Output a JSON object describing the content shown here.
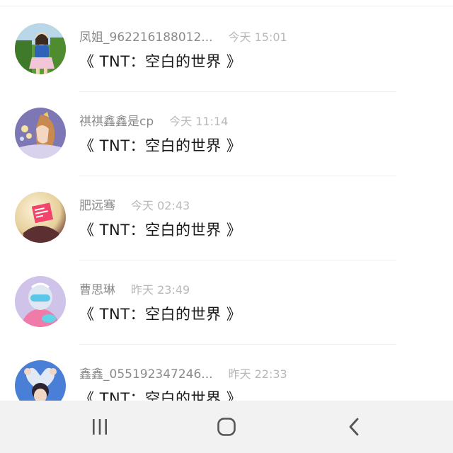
{
  "feed": {
    "items": [
      {
        "name": "凤姐_962216188012...",
        "time": "今天 15:01",
        "message": "《 TNT：空白的世界 》",
        "avatar_icon": "avatar-girl-photo"
      },
      {
        "name": "祺祺鑫鑫是cp",
        "time": "今天 11:14",
        "message": "《 TNT：空白的世界 》",
        "avatar_icon": "avatar-anime-girl"
      },
      {
        "name": "肥远骞",
        "time": "今天 02:43",
        "message": "《 TNT：空白的世界 》",
        "avatar_icon": "avatar-love-note"
      },
      {
        "name": "曹思琳",
        "time": "昨天 23:49",
        "message": "《 TNT：空白的世界 》",
        "avatar_icon": "avatar-helmet-figure"
      },
      {
        "name": "鑫鑫_055192347246...",
        "time": "昨天 22:33",
        "message": "《 TNT：空白的世界 》",
        "avatar_icon": "avatar-heart-hands"
      }
    ]
  },
  "navbar": {
    "buttons": [
      "recent-apps-icon",
      "home-icon",
      "back-icon"
    ],
    "background": "#f2f2f2"
  }
}
